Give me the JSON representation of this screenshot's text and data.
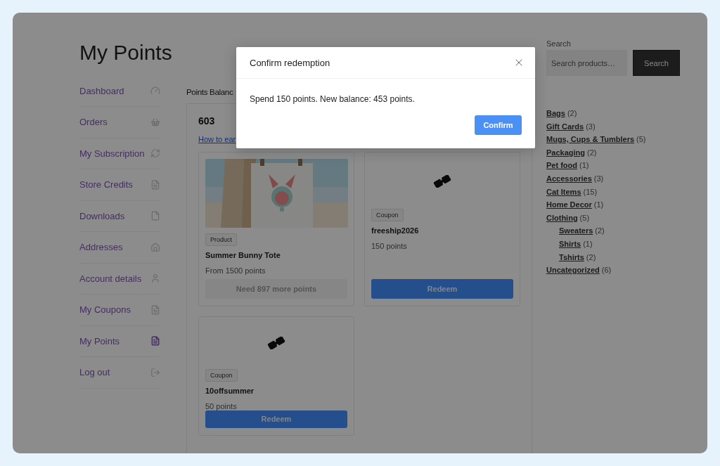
{
  "page": {
    "title": "My Points"
  },
  "nav": [
    {
      "label": "Dashboard",
      "selected": false
    },
    {
      "label": "Orders",
      "selected": false
    },
    {
      "label": "My Subscription",
      "selected": false
    },
    {
      "label": "Store Credits",
      "selected": false
    },
    {
      "label": "Downloads",
      "selected": false
    },
    {
      "label": "Addresses",
      "selected": false
    },
    {
      "label": "Account details",
      "selected": false
    },
    {
      "label": "My Coupons",
      "selected": false
    },
    {
      "label": "My Points",
      "selected": true
    },
    {
      "label": "Log out",
      "selected": false
    }
  ],
  "balance": {
    "label": "Points Balanc",
    "value": "603",
    "link": "How to ear"
  },
  "rewards": [
    {
      "kind": "product",
      "tag": "Product",
      "name": "Summer Bunny Tote",
      "points": "From 1500 points",
      "button": {
        "label": "Need 897 more points",
        "disabled": true
      }
    },
    {
      "kind": "coupon",
      "tag": "Coupon",
      "name": "freeship2026",
      "points": "150 points",
      "button": {
        "label": "Redeem",
        "disabled": false
      }
    },
    {
      "kind": "coupon",
      "tag": "Coupon",
      "name": "10offsummer",
      "points": "50 points",
      "button": {
        "label": "Redeem",
        "disabled": false
      }
    }
  ],
  "sidebar": {
    "search": {
      "label": "Search",
      "placeholder": "Search products…",
      "button": "Search"
    },
    "categories": [
      {
        "name": "Bags",
        "count": "(2)"
      },
      {
        "name": "Gift Cards",
        "count": "(3)"
      },
      {
        "name": "Mugs, Cups & Tumblers",
        "count": "(5)"
      },
      {
        "name": "Packaging",
        "count": "(2)"
      },
      {
        "name": "Pet food",
        "count": "(1)"
      },
      {
        "name": "Accessories",
        "count": "(3)"
      },
      {
        "name": "Cat Items",
        "count": "(15)"
      },
      {
        "name": "Home Decor",
        "count": "(1)"
      },
      {
        "name": "Clothing",
        "count": "(5)",
        "children": [
          {
            "name": "Sweaters",
            "count": "(2)"
          },
          {
            "name": "Shirts",
            "count": "(1)"
          },
          {
            "name": "Tshirts",
            "count": "(2)"
          }
        ]
      },
      {
        "name": "Uncategorized",
        "count": "(6)"
      }
    ]
  },
  "modal": {
    "title": "Confirm redemption",
    "message": "Spend 150 points. New balance: 453 points.",
    "confirm": "Confirm"
  }
}
